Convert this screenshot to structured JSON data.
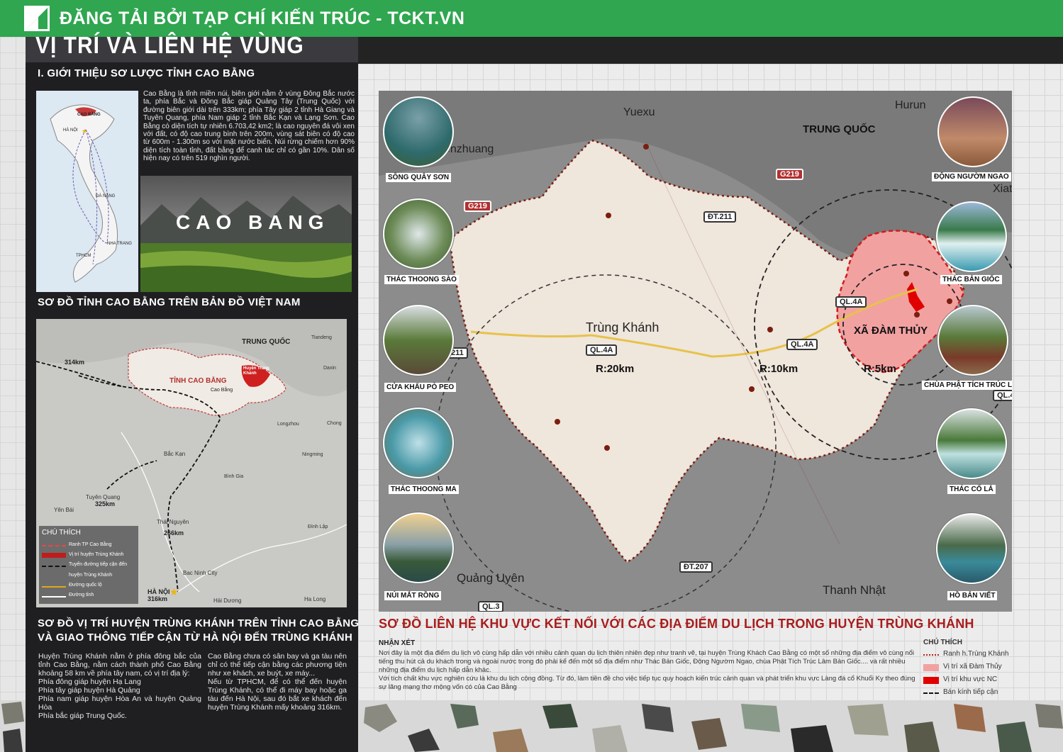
{
  "header": {
    "brand": "ĐĂNG TẢI BỞI TẠP CHÍ KIẾN TRÚC - TCKT.VN"
  },
  "main_title": "VỊ TRÍ VÀ LIÊN HỆ VÙNG",
  "section1": {
    "heading": "I. GIỚI THIỆU SƠ LƯỢC TỈNH CAO BẰNG",
    "vn_map_labels": {
      "cao_bang": "CAO BẰNG",
      "ha_noi": "HÀ NỘI",
      "da_nang": "ĐÀ NẴNG",
      "nha_trang": "NHA TRANG",
      "tphcm": "TPHCM"
    },
    "intro": "Cao Bằng là tỉnh miền núi, biên giới nằm ở vùng Đông Bắc nước ta, phía Bắc và Đông Bắc giáp Quảng Tây (Trung Quốc) với đường biên giới dài trên 333km; phía Tây giáp 2 tỉnh Hà Giang và Tuyên Quang, phía Nam giáp 2 tỉnh Bắc Kạn và Lạng Sơn. Cao Bằng có diện tích tự nhiên 6.703,42 km2; là cao nguyên đá vôi xen với đất, có độ cao trung bình trên 200m, vùng sát biên có độ cao từ 600m - 1.300m so với mặt nước biển. Núi rừng chiếm hơn 90% diện tích toàn tỉnh, đất bằng để canh tác chỉ có gần 10%. Dân số hiện nay có trên 519 nghìn người.",
    "photo_label": "CAO BANG"
  },
  "section2": {
    "heading": "SƠ ĐỒ TỈNH CAO BẰNG TRÊN BẢN ĐỒ VIỆT NAM",
    "map_labels": {
      "trung_quoc": "TRUNG QUỐC",
      "tinh": "TỈNH CAO BẰNG",
      "huyen": "Huyện Trùng Khánh",
      "cao_bang_city": "Cao Bằng",
      "ha_noi": "HÀ NỘI",
      "bac_kan": "Bắc Kạn",
      "tuyen_quang": "Tuyên Quang",
      "thai_nguyen": "Thái Nguyên",
      "bac_ninh": "Bac Ninh City",
      "yen_bai": "Yên Bái",
      "hai_duong": "Hải Dương",
      "ha_long": "Ha Long",
      "long_son": "Longzhou",
      "ning_ming": "Ningming",
      "dinh_lap": "Đình Lập",
      "tiandeng": "Tiandeng",
      "daxin": "Daxin",
      "chong": "Chong",
      "dist_314": "314km",
      "dist_325": "325km",
      "dist_266": "266km",
      "dist_316": "316km",
      "binh_gia": "Bình Gia"
    },
    "legend": {
      "title": "CHÚ THÍCH",
      "items": [
        "Ranh TP Cao Bằng",
        "Vị trí huyện Trùng Khánh",
        "Tuyến đường tiếp cận đến",
        "huyện Trùng Khánh",
        "Đường quốc lộ",
        "Đường tỉnh"
      ]
    }
  },
  "section3": {
    "heading_line1": "SƠ ĐỒ VỊ TRÍ HUYỆN TRÙNG KHÁNH TRÊN TỈNH CAO BẰNG",
    "heading_line2": "VÀ GIAO THÔNG TIẾP CẬN TỪ HÀ NỘI ĐẾN TRÙNG KHÁNH",
    "col1": "Huyện Trùng Khánh nằm ở phía đông bắc của tỉnh Cao Bằng, nằm cách thành phố Cao Bằng khoảng 58 km về phía tây nam, có vị trí địa lý:\nPhía đông giáp huyện Hạ Lang\nPhía tây giáp huyện Hà Quảng\nPhía nam giáp huyện Hòa An và huyện Quảng Hòa\nPhía bắc giáp Trung Quốc.",
    "col2": "Cao Bằng chưa có sân bay và ga tàu nên chỉ có thể tiếp cận bằng các phương tiện như xe khách, xe buýt, xe máy...\nNếu từ TPHCM, để có thể đến huyện Trùng Khánh, có thể đi máy bay hoặc ga tàu đến Hà Nội, sau đó bắt xe khách đến huyện Trùng Khánh mấy khoảng 316km."
  },
  "main_map": {
    "place_labels": {
      "yuexu": "Yuexu",
      "hurun": "Hurun",
      "xiate": "Xiate",
      "zhuang": "enzhuang",
      "trung_quoc": "TRUNG QUỐC",
      "trung_khanh": "Trùng Khánh",
      "xa_dam_thuy": "XÃ ĐÀM THỦY",
      "quang_uyen": "Quảng Uyên",
      "thanh_nhat": "Thanh Nhật"
    },
    "roads": [
      "G219",
      "G219",
      "ĐT.211",
      "QL.4A",
      "QL.4A",
      "QL.4A",
      "211",
      "ĐT.207",
      "QL.3",
      "QL.4"
    ],
    "radii": [
      "R:20km",
      "R:10km",
      "R:5km"
    ],
    "attractions": [
      {
        "label": "SÔNG QUÂY SƠN"
      },
      {
        "label": "THÁC THOONG SÀO"
      },
      {
        "label": "CỬA KHẨU PÒ PEO"
      },
      {
        "label": "THÁC THOONG MA"
      },
      {
        "label": "NÚI MẮT RỒNG"
      },
      {
        "label": "ĐỘNG NGƯỜM NGAO"
      },
      {
        "label": "THÁC BẢN GIỐC"
      },
      {
        "label": "CHÙA PHẬT TÍCH TRÚC LÂM"
      },
      {
        "label": "THÁC CỐ LẢ"
      },
      {
        "label": "HỒ BẢN VIẾT"
      }
    ]
  },
  "section4": {
    "title": "SƠ ĐỒ LIÊN HỆ KHU VỰC KẾT NỐI VỚI CÁC ĐỊA ĐIỂM DU LỊCH TRONG HUYỆN TRÙNG KHÁNH",
    "nhanxet_h": "NHẬN XÉT",
    "nhanxet": "Nơi đây là một địa điểm du lịch vô cùng hấp dẫn với nhiều cảnh quan du lịch thiên nhiên đẹp như tranh vẽ, tại huyện Trùng Khách Cao Bằng có một số những địa điểm vô cùng nổi tiếng thu hút cả du khách trong và ngoài nước trong đó phải kể đến một số địa điểm như Thác Bản Giốc, Động Ngườm Ngao, chùa Phật Tích Trúc Lâm Bản Giốc.... và rất nhiều những địa điểm du lịch hấp dẫn khác.\nVới tích chất khu vực nghiên cứu là khu du lịch cộng đồng. Từ đó, làm tiền đề cho việc tiếp tục quy hoạch kiến trúc cảnh quan và phát triển khu vực Làng đá cổ Khuổi Ky theo đúng sự lãng mạng thơ mộng vốn có của Cao Bằng",
    "legend": {
      "title": "CHÚ THÍCH",
      "items": [
        "Ranh h.Trùng Khánh",
        "Vị trí xã Đàm Thủy",
        "Vị trí khu vực NC",
        "Bán kính tiếp cận"
      ]
    }
  },
  "colors": {
    "green": "#2fa64f",
    "dark": "#1f1f22",
    "accent_red": "#a81c1c",
    "pink": "#f2a1a1"
  }
}
